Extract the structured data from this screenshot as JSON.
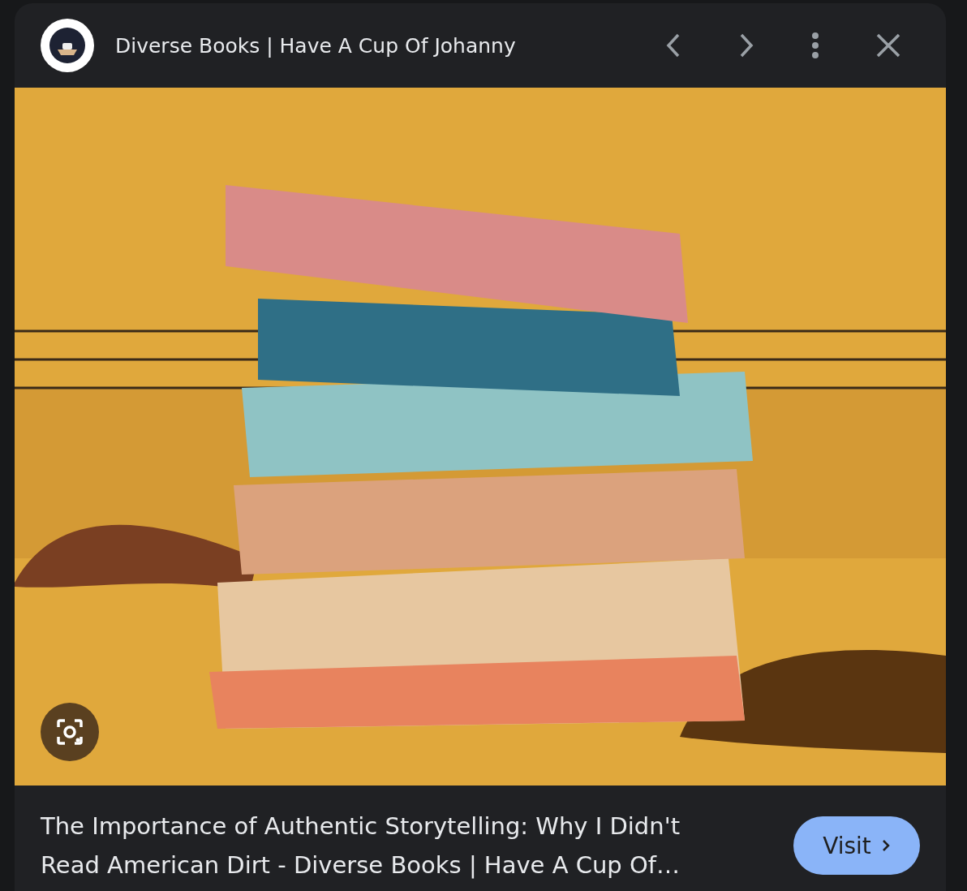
{
  "header": {
    "source_title": "Diverse Books | Have A Cup Of Johanny"
  },
  "result": {
    "title": "The Importance of Authentic Storytelling: Why I Didn't Read American Dirt - Diverse Books | Have A Cup Of…",
    "visit_label": "Visit"
  }
}
